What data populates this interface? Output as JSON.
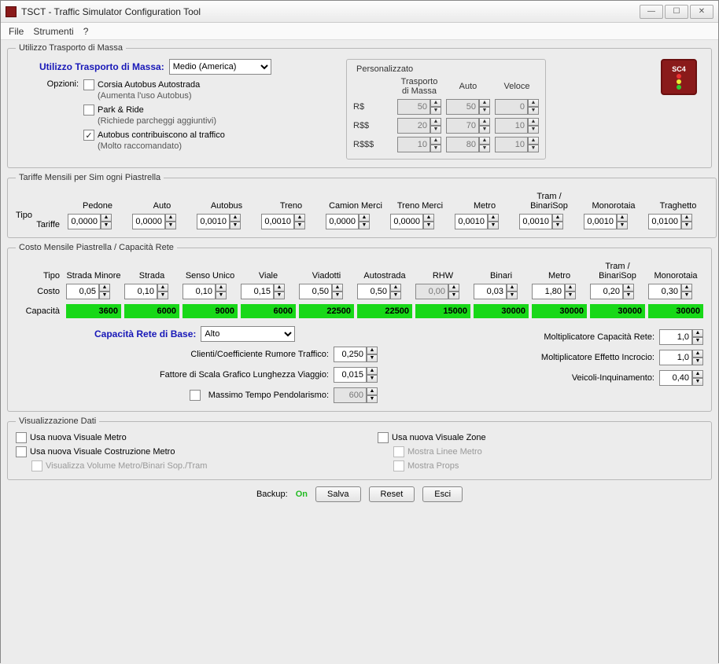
{
  "window": {
    "title": "TSCT - Traffic Simulator Configuration Tool"
  },
  "menu": {
    "file": "File",
    "tools": "Strumenti",
    "help": "?"
  },
  "mass": {
    "legend": "Utilizzo Trasporto di Massa",
    "label": "Utilizzo Trasporto di Massa:",
    "level": "Medio (America)",
    "options_label": "Opzioni:",
    "opt1": "Corsia Autobus Autostrada",
    "opt1sub": "(Aumenta l'uso Autobus)",
    "opt2": "Park & Ride",
    "opt2sub": "(Richiede parcheggi aggiuntivi)",
    "opt3": "Autobus contribuiscono al traffico",
    "opt3sub": "(Molto raccomandato)",
    "custom": {
      "legend": "Personalizzato",
      "h_mass": "Trasporto di Massa",
      "h_auto": "Auto",
      "h_speed": "Veloce",
      "r1": "R$",
      "r1a": "50",
      "r1b": "50",
      "r1c": "0",
      "r2": "R$$",
      "r2a": "20",
      "r2b": "70",
      "r2c": "10",
      "r3": "R$$$",
      "r3a": "10",
      "r3b": "80",
      "r3c": "10"
    }
  },
  "tariffs": {
    "legend": "Tariffe Mensili per Sim ogni Piastrella",
    "type": "Tipo",
    "rowlabel": "Tariffe",
    "cols": [
      "Pedone",
      "Auto",
      "Autobus",
      "Treno",
      "Camion Merci",
      "Treno Merci",
      "Metro",
      "Tram / BinariSop",
      "Monorotaia",
      "Traghetto"
    ],
    "vals": [
      "0,0000",
      "0,0000",
      "0,0010",
      "0,0010",
      "0,0000",
      "0,0000",
      "0,0010",
      "0,0010",
      "0,0010",
      "0,0100"
    ]
  },
  "cost": {
    "legend": "Costo Mensile Piastrella / Capacità Rete",
    "type": "Tipo",
    "costlabel": "Costo",
    "caplabel": "Capacità",
    "cols": [
      "Strada Minore",
      "Strada",
      "Senso Unico",
      "Viale",
      "Viadotti",
      "Autostrada",
      "RHW",
      "Binari",
      "Metro",
      "Tram / BinariSop",
      "Monorotaia"
    ],
    "costs": [
      "0,05",
      "0,10",
      "0,10",
      "0,15",
      "0,50",
      "0,50",
      "0,00",
      "0,03",
      "1,80",
      "0,20",
      "0,30"
    ],
    "caps": [
      "3600",
      "6000",
      "9000",
      "6000",
      "22500",
      "22500",
      "15000",
      "30000",
      "30000",
      "30000",
      "30000"
    ],
    "basecap_label": "Capacità Rete di Base:",
    "basecap": "Alto",
    "f1": "Clienti/Coefficiente Rumore Traffico:",
    "f1v": "0,250",
    "f2": "Fattore di Scala Grafico Lunghezza Viaggio:",
    "f2v": "0,015",
    "f3": "Massimo Tempo Pendolarismo:",
    "f3v": "600",
    "g1": "Moltiplicatore Capacità Rete:",
    "g1v": "1,0",
    "g2": "Moltiplicatore Effetto Incrocio:",
    "g2v": "1,0",
    "g3": "Veicoli-Inquinamento:",
    "g3v": "0,40"
  },
  "viz": {
    "legend": "Visualizzazione Dati",
    "v1": "Usa nuova Visuale Metro",
    "v2": "Usa nuova Visuale Costruzione Metro",
    "v2a": "Visualizza Volume Metro/Binari Sop./Tram",
    "v3": "Usa nuova Visuale Zone",
    "v3a": "Mostra Linee Metro",
    "v3b": "Mostra Props"
  },
  "footer": {
    "backup": "Backup:",
    "on": "On",
    "save": "Salva",
    "reset": "Reset",
    "exit": "Esci"
  },
  "logo": "SC4"
}
